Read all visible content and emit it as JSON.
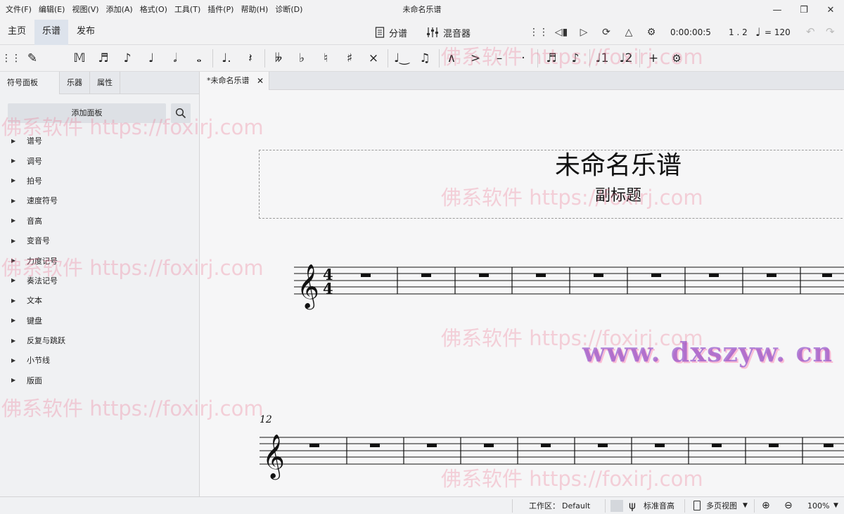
{
  "menubar": {
    "items": [
      "文件(F)",
      "编辑(E)",
      "视图(V)",
      "添加(A)",
      "格式(O)",
      "工具(T)",
      "插件(P)",
      "帮助(H)",
      "诊断(D)"
    ]
  },
  "window": {
    "title": "未命名乐谱"
  },
  "app_tabs": [
    "主页",
    "乐谱",
    "发布"
  ],
  "active_app_tab": "乐谱",
  "toolbar": {
    "parts_label": "分谱",
    "mixer_label": "混音器",
    "time_readout": "0:00:00:5",
    "position_readout": "1 . 2",
    "tempo_readout": "= 120"
  },
  "left_panel": {
    "tabs": [
      "符号面板",
      "乐器",
      "属性"
    ],
    "add_panel_label": "添加面板",
    "palettes": [
      "谱号",
      "调号",
      "拍号",
      "速度符号",
      "音高",
      "变音号",
      "力度记号",
      "奏法记号",
      "文本",
      "键盘",
      "反复与跳跃",
      "小节线",
      "版面"
    ]
  },
  "document": {
    "tab_label": "*未命名乐谱",
    "title": "未命名乐谱",
    "subtitle": "副标题",
    "time_signature_top": "4",
    "time_signature_bottom": "4",
    "second_system_measure_number": "12"
  },
  "statusbar": {
    "workspace_label": "工作区：",
    "workspace_value": "Default",
    "tuning_label": "标准音高",
    "view_mode": "多页视图",
    "zoom": "100%"
  },
  "watermarks": {
    "foxirj": "佛系软件 https://foxirj.com",
    "dxszyw": "www. dxszyw. cn"
  }
}
